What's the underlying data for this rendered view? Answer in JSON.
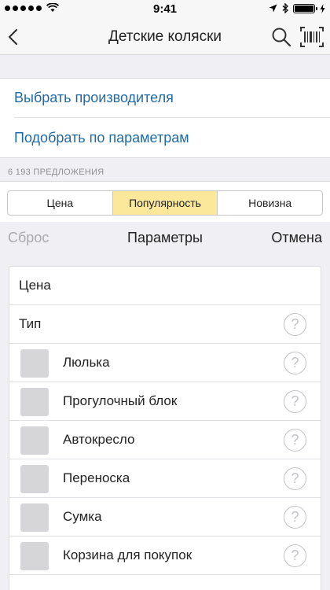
{
  "status_bar": {
    "time": "9:41",
    "battery_level": 1.0
  },
  "nav": {
    "title": "Детские коляски",
    "icons": [
      "back-chevron-icon",
      "search-icon",
      "barcode-icon"
    ]
  },
  "links": [
    {
      "label": "Выбрать производителя"
    },
    {
      "label": "Подобрать по параметрам"
    }
  ],
  "offers_count": "6 193 ПРЕДЛОЖЕНИЯ",
  "sort_tabs": [
    {
      "label": "Цена",
      "active": false
    },
    {
      "label": "Популярность",
      "active": true
    },
    {
      "label": "Новизна",
      "active": false
    }
  ],
  "params_header": {
    "reset_label": "Сброс",
    "title": "Параметры",
    "cancel_label": "Отмена"
  },
  "params": {
    "price_label": "Цена",
    "type_label": "Тип",
    "help_symbol": "?",
    "options": [
      {
        "label": "Люлька",
        "checked": false
      },
      {
        "label": "Прогулочный блок",
        "checked": false
      },
      {
        "label": "Автокресло",
        "checked": false
      },
      {
        "label": "Переноска",
        "checked": false
      },
      {
        "label": "Сумка",
        "checked": false
      },
      {
        "label": "Корзина для покупок",
        "checked": false
      }
    ]
  },
  "colors": {
    "link": "#1f6aa5",
    "active_tab": "#fbe89b",
    "background": "#efeff4"
  }
}
